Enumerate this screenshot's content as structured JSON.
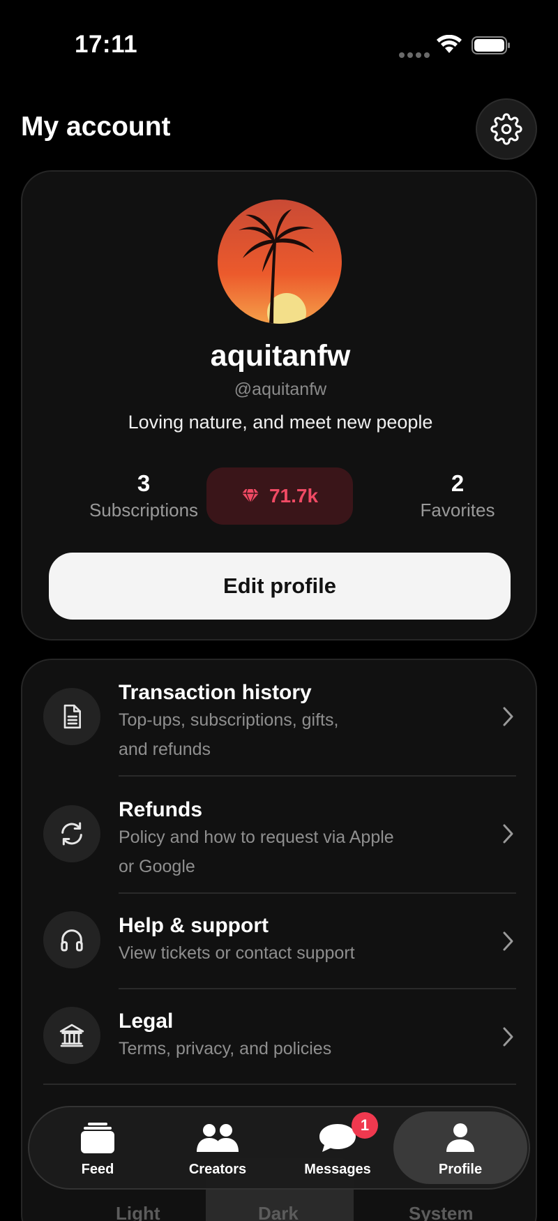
{
  "status_bar": {
    "time": "17:11"
  },
  "header": {
    "title": "My account"
  },
  "profile": {
    "display_name": "aquitanfw",
    "handle": "@aquitanfw",
    "bio": "Loving nature, and meet new people",
    "stats": {
      "subscriptions_value": "3",
      "subscriptions_label": "Subscriptions",
      "gems_value": "71.7k",
      "favorites_value": "2",
      "favorites_label": "Favorites"
    },
    "edit_button_label": "Edit profile"
  },
  "menu": {
    "items": [
      {
        "title": "Transaction history",
        "subtitle_line1": "Top-ups, subscriptions, gifts,",
        "subtitle_line2": "and refunds",
        "icon": "document-icon"
      },
      {
        "title": "Refunds",
        "subtitle_line1": "Policy and how to request via Apple",
        "subtitle_line2": "or Google",
        "icon": "refresh-icon"
      },
      {
        "title": "Help & support",
        "subtitle_line1": "View tickets or contact support",
        "icon": "headphones-icon"
      },
      {
        "title": "Legal",
        "subtitle_line1": "Terms, privacy, and policies",
        "icon": "bank-icon"
      }
    ]
  },
  "theme": {
    "light": "Light",
    "dark": "Dark",
    "system": "System"
  },
  "tab_bar": {
    "tabs": [
      {
        "label": "Feed"
      },
      {
        "label": "Creators"
      },
      {
        "label": "Messages",
        "badge": "1"
      },
      {
        "label": "Profile",
        "active": true
      }
    ]
  },
  "colors": {
    "accent": "#f04a64",
    "badge": "#f0394f",
    "background": "#000000",
    "card": "#111111"
  }
}
